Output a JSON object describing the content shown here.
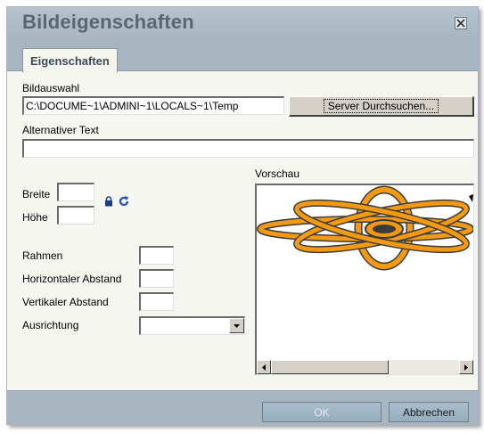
{
  "dialog": {
    "title": "Bildeigenschaften",
    "close_icon": "close-x-icon"
  },
  "tabs": [
    {
      "label": "Eigenschaften",
      "active": true
    }
  ],
  "form": {
    "bildauswahl_label": "Bildauswahl",
    "bildauswahl_value": "C:\\DOCUME~1\\ADMINI~1\\LOCALS~1\\Temp",
    "browse_button": "Server Durchsuchen...",
    "alt_text_label": "Alternativer Text",
    "alt_text_value": "",
    "breite_label": "Breite",
    "breite_value": "",
    "hoehe_label": "Höhe",
    "hoehe_value": "",
    "lock_icon": "lock-icon",
    "reset_icon": "reset-refresh-icon",
    "rahmen_label": "Rahmen",
    "rahmen_value": "",
    "h_abstand_label": "Horizontaler Abstand",
    "h_abstand_value": "",
    "v_abstand_label": "Vertikaler Abstand",
    "v_abstand_value": "",
    "ausrichtung_label": "Ausrichtung",
    "ausrichtung_value": ""
  },
  "preview": {
    "label": "Vorschau",
    "image_icon": "atom-logo-image"
  },
  "footer": {
    "ok_label": "OK",
    "cancel_label": "Abbrechen"
  },
  "colors": {
    "titlebar": "#a7b6c1",
    "title_text": "#5a6670",
    "dialog_bg": "#f6f6f0",
    "atom_orange": "#f39a12",
    "atom_dark": "#3b3b3b"
  }
}
